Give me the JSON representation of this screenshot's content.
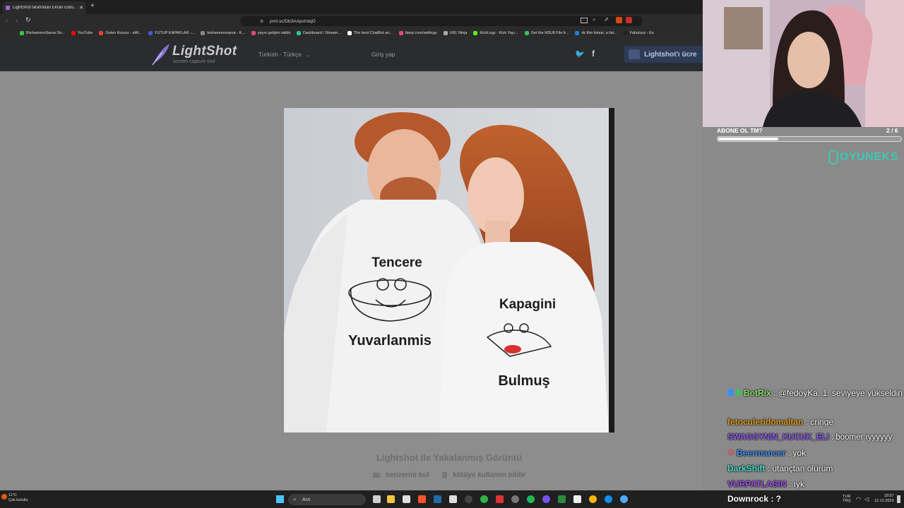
{
  "browser": {
    "tab_title": "LightShot tarafından Ekran Görü...",
    "url": "prnt.sc/Db3AApxIntqO",
    "bookmarks": [
      {
        "label": "BishamonnSama Str...",
        "color": "#2ecc40"
      },
      {
        "label": "YouTube",
        "color": "#ff0000"
      },
      {
        "label": "Gelen Kutusu - elift...",
        "color": "#ea4335"
      },
      {
        "label": "YUTUP KAPAKLAR -...",
        "color": "#3b5bdb"
      },
      {
        "label": "bishamonnsama - K...",
        "color": "#888888"
      },
      {
        "label": "yayın gelişim takibi",
        "color": "#e64980"
      },
      {
        "label": "Dashboard / Stream...",
        "color": "#20c997"
      },
      {
        "label": "The best ChatBot an...",
        "color": "#ffffff"
      },
      {
        "label": "bierp.com/settings",
        "color": "#e64980"
      },
      {
        "label": "URL Ninja",
        "color": "#aaaaaa"
      },
      {
        "label": "KickLogz - Kick Yayı...",
        "color": "#53fc18"
      },
      {
        "label": "Get the M3U8 File fr...",
        "color": "#40c057"
      },
      {
        "label": "dc film listesi, a list...",
        "color": "#1c7ed6"
      },
      {
        "label": "Fabulous - Ee",
        "color": "#222222"
      }
    ]
  },
  "lightshot": {
    "brand": "LightShot",
    "tagline": "screen capture tool",
    "language": "Turkish - Türkçe",
    "login": "Giriş yap",
    "download_button": "Lightshot'ı ücre",
    "caption": "Lightshot ile Yakalanmış Görüntü",
    "find_similar": "benzerini bul",
    "report_abuse": "kötüye kullanım bildir"
  },
  "shirts": {
    "left_top": "Tencere",
    "left_bottom": "Yuvarlanmis",
    "right_top": "Kapagini",
    "right_bottom": "Bulmuş"
  },
  "stream": {
    "goal_label": "ABONE OL TM?",
    "goal_count": "2 / 6",
    "goal_progress": 0.33,
    "sponsor": "OYUNEKS",
    "chat": [
      {
        "user": "BotRix",
        "user_color": "#8fe36b",
        "message": "@fedoyKa, 1. seviyeye yükseldin"
      },
      {
        "user": "fetoculeridomaltan",
        "user_color": "#e09b1b",
        "message": "cringe"
      },
      {
        "user": "SWAGGYNIN_KUCUK_ELI",
        "user_color": "#8e5cf0",
        "message": "boomer ıyyyyyy"
      },
      {
        "user": "Beermancer",
        "user_color": "#3d8ff0",
        "message": "yok"
      },
      {
        "user": "DarkShift",
        "user_color": "#48e0c8",
        "message": "utançtan ölürüm"
      },
      {
        "user": "VURPATLASIN",
        "user_color": "#9b4de8",
        "message": "ıyk"
      }
    ],
    "alert": "Downrock : ?"
  },
  "taskbar": {
    "weather_temp": "11°C",
    "weather_desc": "Çok bulutlu",
    "search_placeholder": "Ara",
    "lang_top": "TUR",
    "lang_bottom": "TRQ",
    "time": "18:57",
    "date": "12.12.2023"
  }
}
